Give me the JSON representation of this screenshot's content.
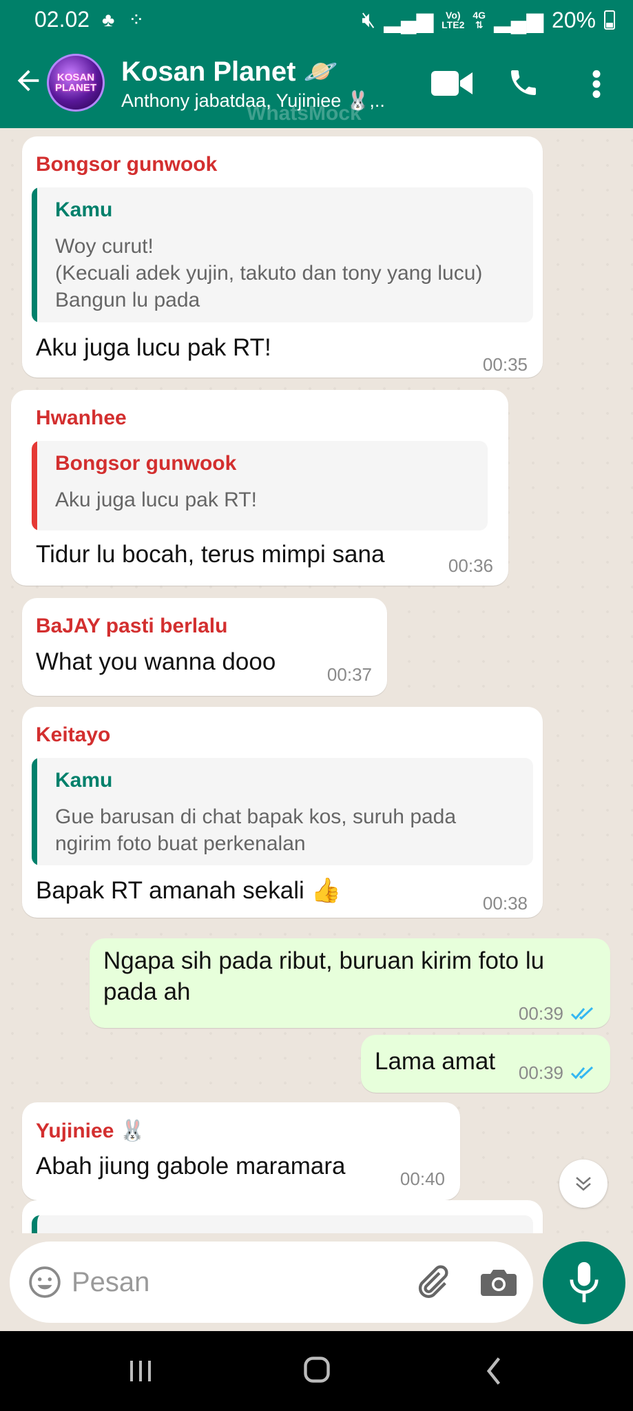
{
  "status_bar": {
    "time": "02.02",
    "net_top": "Vo)",
    "net_bottom": "LTE2",
    "net2_top": "4G",
    "battery": "20%"
  },
  "header": {
    "avatar_line1": "KOSAN",
    "avatar_line2": "PLANET",
    "title": "Kosan Planet 🪐",
    "subtitle": "Anthony jabatdaa, Yujiniee 🐰,..",
    "watermark": "WhatsMock"
  },
  "messages": [
    {
      "sender": "Bongsor gunwook",
      "quote_name": "Kamu",
      "quote_lines": [
        "Woy curut!",
        "(Kecuali adek yujin, takuto dan tony yang lucu)",
        "Bangun lu pada"
      ],
      "text": "Aku juga lucu pak RT!",
      "time": "00:35"
    },
    {
      "sender": "Hwanhee",
      "quote_name": "Bongsor gunwook",
      "quote_lines": [
        "Aku juga lucu pak RT!"
      ],
      "text": "Tidur lu bocah, terus mimpi sana",
      "time": "00:36"
    },
    {
      "sender": "BaJAY pasti berlalu",
      "text": "What you wanna dooo",
      "time": "00:37"
    },
    {
      "sender": "Keitayo",
      "quote_name": "Kamu",
      "quote_lines": [
        "Gue barusan di chat bapak kos, suruh pada",
        "ngirim foto buat perkenalan"
      ],
      "text": "Bapak RT amanah sekali 👍",
      "time": "00:38"
    },
    {
      "outgoing": true,
      "text_lines": [
        "Ngapa sih pada ribut, buruan kirim foto lu",
        "pada ah"
      ],
      "time": "00:39"
    },
    {
      "outgoing": true,
      "text": "Lama amat",
      "time": "00:39"
    },
    {
      "sender": "Yujiniee 🐰",
      "text": "Abah jiung gabole maramara",
      "time": "00:40"
    }
  ],
  "input": {
    "placeholder": "Pesan"
  },
  "colors": {
    "brand": "#008069",
    "outgoing_bubble": "#e7ffdb",
    "sender_red": "#d32f2f",
    "self_quote": "#00806b",
    "read_ticks": "#34b7f1"
  }
}
